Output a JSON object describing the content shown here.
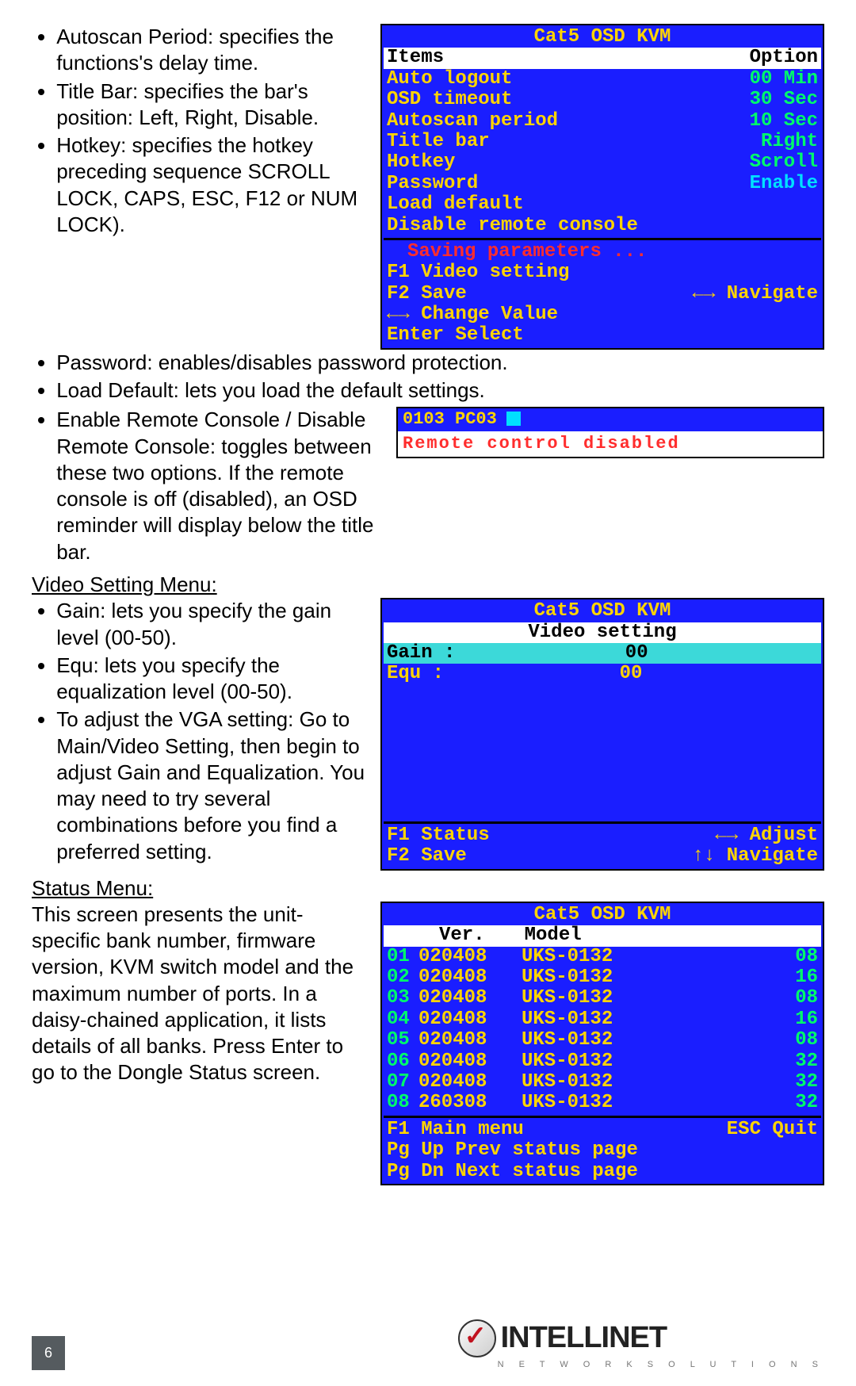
{
  "bullets_top": {
    "b1": "Autoscan Period: specifies the functions's delay time.",
    "b2": "Title Bar: specifies the bar's position: Left, Right, Disable.",
    "b3": "Hotkey: specifies the hotkey preceding sequence SCROLL LOCK, CAPS, ESC, F12 or NUM LOCK).",
    "b4": "Password: enables/disables password protection.",
    "b5": "Load Default: lets you load the default settings.",
    "b6": "Enable Remote Console / Disable Remote Console: toggles between these two options. If the remote console is off (disabled), an OSD reminder will display below the title bar."
  },
  "osd1": {
    "title": "Cat5 OSD KVM",
    "hdr_left": "Items",
    "hdr_right": "Option",
    "rows": [
      {
        "k": "Auto logout",
        "v": "00  Min"
      },
      {
        "k": "OSD timeout",
        "v": "30  Sec"
      },
      {
        "k": "Autoscan period",
        "v": "10  Sec"
      },
      {
        "k": "Title bar",
        "v": "Right"
      },
      {
        "k": "Hotkey",
        "v": "Scroll"
      },
      {
        "k": "Password",
        "v": "Enable",
        "cyan": true
      },
      {
        "k": "Load default",
        "v": ""
      },
      {
        "k": "Disable remote console",
        "v": ""
      }
    ],
    "status": "Saving parameters ...",
    "f1": "F1  Video setting",
    "f2l": "F2  Save",
    "f2r": "←→  Navigate",
    "ch": "←→ Change Value",
    "en": "Enter Select"
  },
  "mini": {
    "code": "0103 PC03",
    "msg": "Remote control disabled"
  },
  "video_head": "Video Setting Menu:",
  "video_b1": "Gain: lets you specify the gain level (00-50).",
  "video_b2": "Equ: lets you specify the equalization level (00-50).",
  "video_b3": "To adjust the VGA setting: Go to Main/Video Setting, then begin to adjust Gain and Equalization. You may need to try several combinations before you find a preferred setting.",
  "osd2": {
    "title": "Cat5 OSD KVM",
    "sub": "Video setting",
    "gain_l": "Gain :",
    "gain_v": "00",
    "equ_l": "Equ  :",
    "equ_v": "00",
    "f1l": "F1   Status",
    "f1r": "←→   Adjust",
    "f2l": "F2   Save",
    "f2r": "↑↓ Navigate"
  },
  "status_head": "Status Menu:",
  "status_body": "This screen presents the unit-specific bank number, firmware version, KVM switch model and the maximum number of ports. In a daisy-chained application, it lists details of all banks. Press Enter to go to the Dongle Status screen.",
  "osd3": {
    "title": "Cat5 OSD KVM",
    "h1": "Ver.",
    "h2": "Model",
    "rows": [
      {
        "n": "01",
        "v": "020408",
        "m": "UKS-0132",
        "p": "08"
      },
      {
        "n": "02",
        "v": "020408",
        "m": "UKS-0132",
        "p": "16"
      },
      {
        "n": "03",
        "v": "020408",
        "m": "UKS-0132",
        "p": "08"
      },
      {
        "n": "04",
        "v": "020408",
        "m": "UKS-0132",
        "p": "16"
      },
      {
        "n": "05",
        "v": "020408",
        "m": "UKS-0132",
        "p": "08"
      },
      {
        "n": "06",
        "v": "020408",
        "m": "UKS-0132",
        "p": "32"
      },
      {
        "n": "07",
        "v": "020408",
        "m": "UKS-0132",
        "p": "32"
      },
      {
        "n": "08",
        "v": "260308",
        "m": "UKS-0132",
        "p": "32"
      }
    ],
    "f1l": "F1  Main menu",
    "f1r": "ESC Quit",
    "l2": "Pg  Up Prev status page",
    "l3": "Pg  Dn Next status page"
  },
  "page": "6",
  "brand": "INTELLINET",
  "brand_sub": "N E T W O R K   S O L U T I O N S"
}
